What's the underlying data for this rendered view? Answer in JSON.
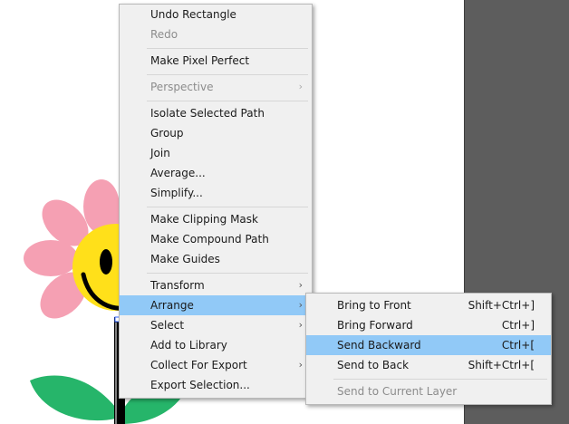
{
  "colors": {
    "menu_bg": "#f0f0f0",
    "highlight": "#91c9f7",
    "disabled_text": "#8c8c8c",
    "pasteboard": "#5d5d5d",
    "petal": "#f5a0b3",
    "face": "#ffe01a",
    "leaf": "#26b56a"
  },
  "context_menu": {
    "items": [
      {
        "label": "Undo Rectangle"
      },
      {
        "label": "Redo",
        "disabled": true
      },
      {
        "label": "Make Pixel Perfect"
      },
      {
        "label": "Perspective",
        "disabled": true,
        "submenu_icon": "chevron-right-icon"
      },
      {
        "label": "Isolate Selected Path"
      },
      {
        "label": "Group"
      },
      {
        "label": "Join"
      },
      {
        "label": "Average..."
      },
      {
        "label": "Simplify..."
      },
      {
        "label": "Make Clipping Mask"
      },
      {
        "label": "Make Compound Path"
      },
      {
        "label": "Make Guides"
      },
      {
        "label": "Transform",
        "submenu_icon": "chevron-right-icon"
      },
      {
        "label": "Arrange",
        "submenu_icon": "chevron-right-icon",
        "highlighted": true
      },
      {
        "label": "Select",
        "submenu_icon": "chevron-right-icon"
      },
      {
        "label": "Add to Library"
      },
      {
        "label": "Collect For Export",
        "submenu_icon": "chevron-right-icon"
      },
      {
        "label": "Export Selection..."
      }
    ],
    "arrow_glyph": "›"
  },
  "arrange_submenu": {
    "items": [
      {
        "label": "Bring to Front",
        "shortcut": "Shift+Ctrl+]"
      },
      {
        "label": "Bring Forward",
        "shortcut": "Ctrl+]"
      },
      {
        "label": "Send Backward",
        "shortcut": "Ctrl+[",
        "highlighted": true
      },
      {
        "label": "Send to Back",
        "shortcut": "Shift+Ctrl+["
      },
      {
        "label": "Send to Current Layer",
        "disabled": true
      }
    ]
  }
}
